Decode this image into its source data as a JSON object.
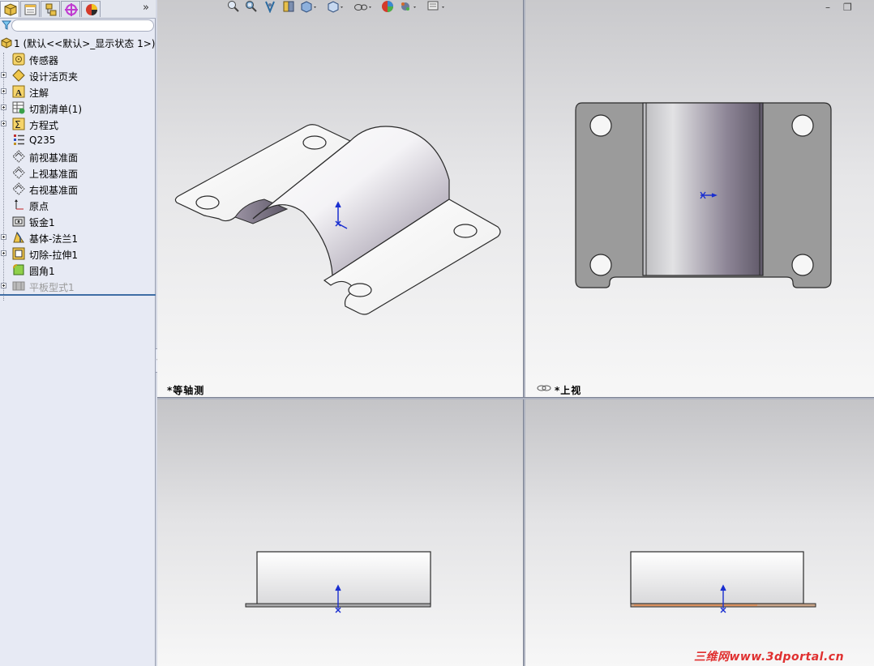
{
  "panel_tabs": [
    {
      "name": "featuremanager-tab-icon"
    },
    {
      "name": "propertymanager-tab-icon"
    },
    {
      "name": "configurationmanager-tab-icon"
    },
    {
      "name": "dimxpert-tab-icon"
    },
    {
      "name": "display-manager-tab-icon"
    }
  ],
  "panel_more": "»",
  "tree": {
    "root_label": "1  (默认<<默认>_显示状态 1>)",
    "items": [
      {
        "label": "传感器",
        "icon": "sensor-icon",
        "expandable": false,
        "suppressed": false
      },
      {
        "label": "设计活页夹",
        "icon": "design-binder-icon",
        "expandable": true,
        "suppressed": false
      },
      {
        "label": "注解",
        "icon": "annotations-icon",
        "expandable": true,
        "suppressed": false
      },
      {
        "label": "切割清单(1)",
        "icon": "cut-list-icon",
        "expandable": true,
        "suppressed": false
      },
      {
        "label": "方程式",
        "icon": "equations-icon",
        "expandable": true,
        "suppressed": false
      },
      {
        "label": "Q235",
        "icon": "material-icon",
        "expandable": false,
        "suppressed": false
      },
      {
        "label": "前视基准面",
        "icon": "plane-icon",
        "expandable": false,
        "suppressed": false
      },
      {
        "label": "上视基准面",
        "icon": "plane-icon",
        "expandable": false,
        "suppressed": false
      },
      {
        "label": "右视基准面",
        "icon": "plane-icon",
        "expandable": false,
        "suppressed": false
      },
      {
        "label": "原点",
        "icon": "origin-icon",
        "expandable": false,
        "suppressed": false
      },
      {
        "label": "钣金1",
        "icon": "sheet-metal-icon",
        "expandable": false,
        "suppressed": false
      },
      {
        "label": "基体-法兰1",
        "icon": "base-flange-icon",
        "expandable": true,
        "suppressed": false
      },
      {
        "label": "切除-拉伸1",
        "icon": "cut-extrude-icon",
        "expandable": true,
        "suppressed": false
      },
      {
        "label": "圆角1",
        "icon": "fillet-icon",
        "expandable": false,
        "suppressed": false
      },
      {
        "label": "平板型式1",
        "icon": "flat-pattern-icon",
        "expandable": true,
        "suppressed": true
      }
    ]
  },
  "viewports": {
    "iso_label": "*等轴测",
    "top_label": "*上视"
  },
  "heads_up_toolbar": [
    "zoom-to-fit-icon",
    "zoom-to-area-icon",
    "previous-view-icon",
    "section-view-icon",
    "view-orientation-icon",
    "display-style-icon",
    "hide-show-items-icon",
    "edit-appearance-icon",
    "apply-scene-icon",
    "view-settings-icon"
  ],
  "window_controls": {
    "minimize": "–",
    "restore": "❐"
  },
  "watermark": "三维网www.3dportal.cn",
  "colors": {
    "accent": "#3f6ea5",
    "part_shade": "#6e6478",
    "origin": "#1a2fd0",
    "watermark": "#e03030"
  }
}
